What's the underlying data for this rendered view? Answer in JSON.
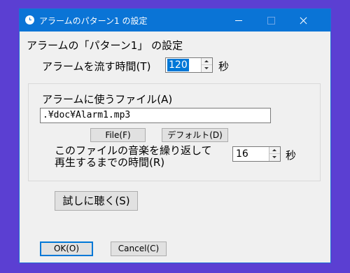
{
  "window": {
    "title": "アラームのパターン1 の設定"
  },
  "dialog": {
    "heading": "アラームの「パターン1」 の設定",
    "duration": {
      "label": "アラームを流す時間(T)",
      "value": "120",
      "unit": "秒"
    },
    "file_group": {
      "label": "アラームに使うファイル(A)",
      "path": ".¥doc¥Alarm1.mp3",
      "file_button": "File(F)",
      "default_button": "デフォルト(D)",
      "repeat_label_line1": "このファイルの音楽を繰り返して",
      "repeat_label_line2": "再生するまでの時間(R)",
      "repeat_value": "16",
      "repeat_unit": "秒"
    },
    "test_button": "試しに聴く(S)",
    "ok_button": "OK(O)",
    "cancel_button": "Cancel(C)"
  },
  "colors": {
    "desktop": "#5b3fd2",
    "titlebar": "#0a74d6",
    "selection": "#0078d7"
  }
}
